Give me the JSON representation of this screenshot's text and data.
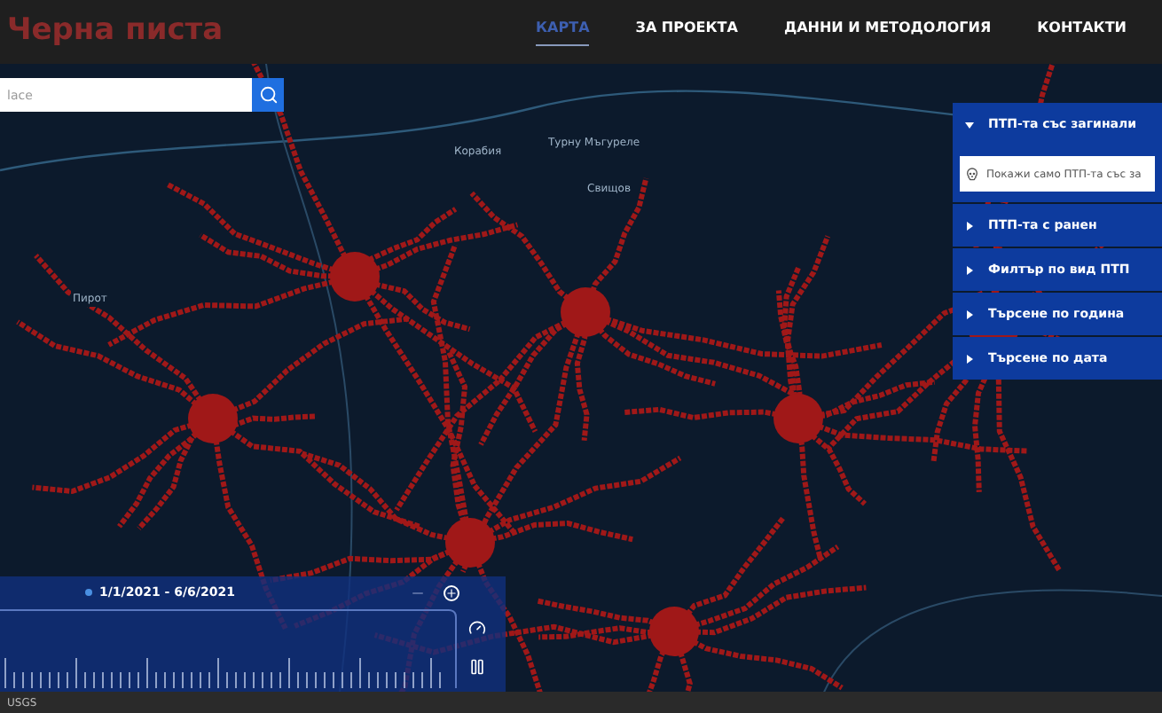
{
  "header": {
    "logo": "Черна писта",
    "nav": [
      {
        "label": "КАРТА",
        "selected": true
      },
      {
        "label": "ЗА ПРОЕКТА",
        "selected": false
      },
      {
        "label": "ДАННИ И МЕТОДОЛОГИЯ",
        "selected": false
      },
      {
        "label": "КОНТАКТИ",
        "selected": false
      }
    ]
  },
  "search": {
    "placeholder": "lace"
  },
  "map_labels": [
    "Корабия",
    "Турну Мъгуреле",
    "Свищов",
    "Пирот"
  ],
  "filters": [
    {
      "label": "ПТП-та със загинали",
      "expanded": true,
      "option": "Покажи само ПТП-та със за"
    },
    {
      "label": "ПТП-та с ранен",
      "expanded": false
    },
    {
      "label": "Филтър по вид ПТП",
      "expanded": false
    },
    {
      "label": "Търсене по година",
      "expanded": false
    },
    {
      "label": "Търсене по дата",
      "expanded": false
    }
  ],
  "timeline": {
    "range": "1/1/2021 - 6/6/2021"
  },
  "attribution": "USGS"
}
